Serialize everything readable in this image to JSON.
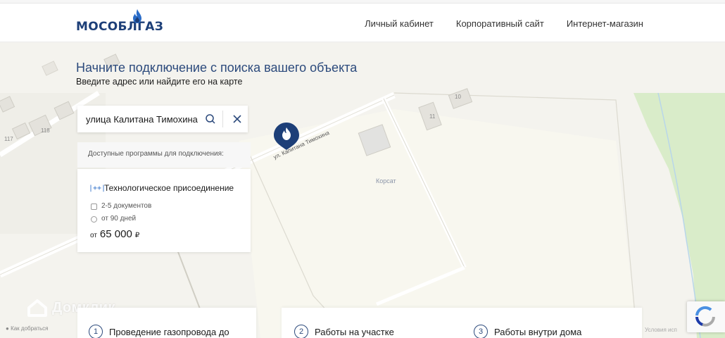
{
  "header": {
    "logo_text": "МОСОБЛГАЗ",
    "nav": [
      "Личный кабинет",
      "Корпоративный сайт",
      "Интернет-магазин"
    ]
  },
  "hero": {
    "title": "Начните подключение с поиска вашего объекта",
    "subtitle": "Введите адрес или найдите его на карте"
  },
  "search": {
    "value": "улица Калитана Тимохина"
  },
  "programs": {
    "label": "Доступные программы для подключения:",
    "card": {
      "icon_text": "|++|",
      "title": "Технологическое присоединение",
      "documents": "2-5 документов",
      "duration": "от 90 дней",
      "price_prefix": "от",
      "price": "65 000",
      "currency": "₽"
    }
  },
  "map": {
    "street": "ул. Капитана Тимохина",
    "place": "Корсат",
    "house_numbers": [
      "10",
      "11",
      "118",
      "117"
    ],
    "watermark": "Домклик",
    "link": "Как добраться",
    "terms": "Условия исп"
  },
  "steps": [
    {
      "num": "1",
      "label": "Проведение газопровода до"
    },
    {
      "num": "2",
      "label": "Работы на участке"
    },
    {
      "num": "3",
      "label": "Работы внутри дома"
    }
  ],
  "colors": {
    "brand": "#1d3f78",
    "accent": "#2a6cc8",
    "park": "#d6ebc8"
  }
}
